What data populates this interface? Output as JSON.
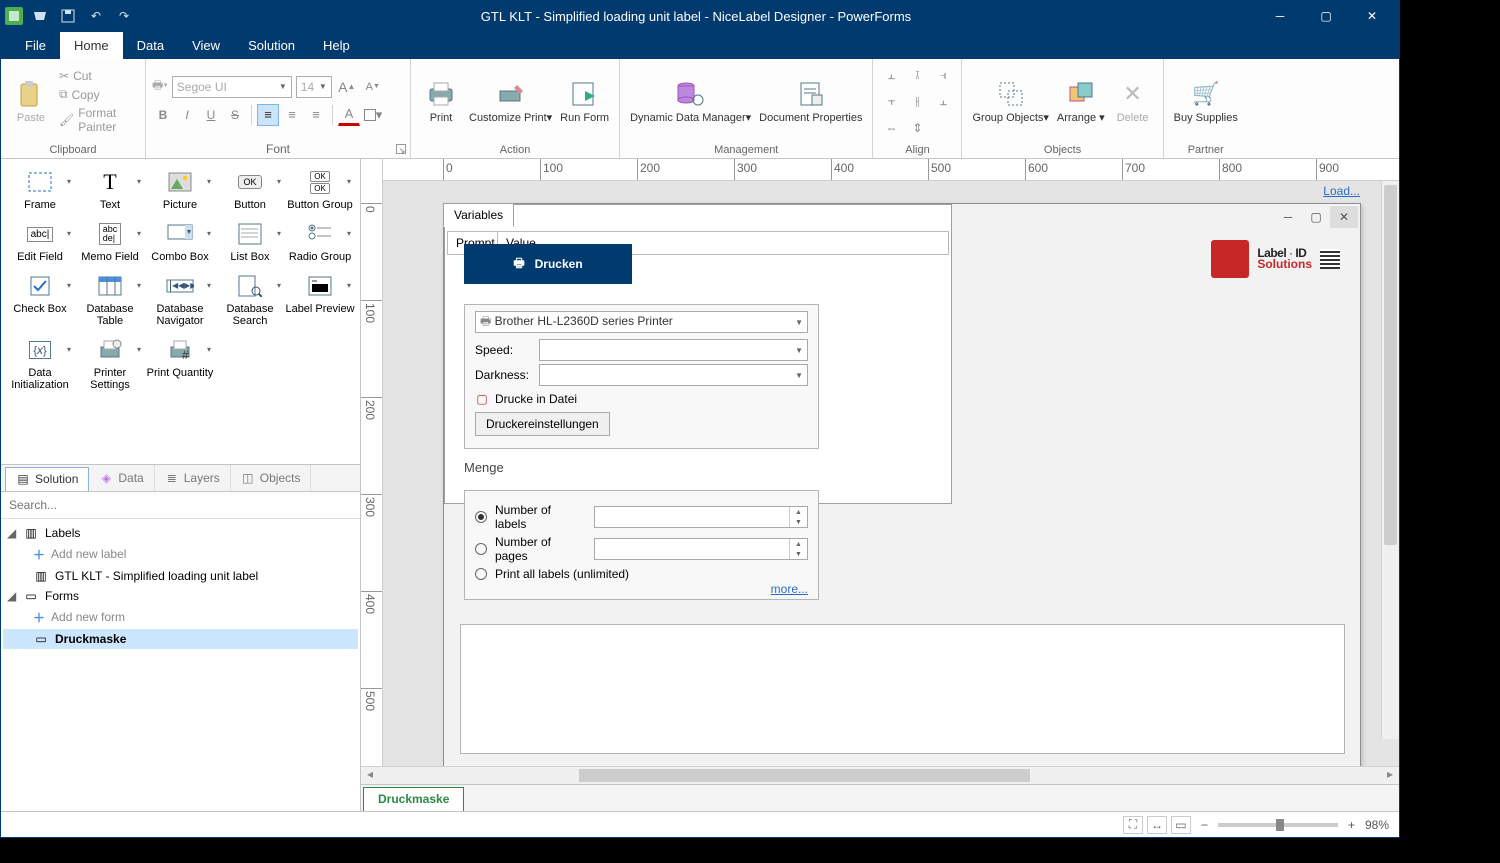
{
  "title": "GTL KLT - Simplified loading unit label - NiceLabel Designer - PowerForms",
  "menu": {
    "file": "File",
    "home": "Home",
    "data": "Data",
    "view": "View",
    "solution": "Solution",
    "help": "Help"
  },
  "ribbon": {
    "clipboard": {
      "label": "Clipboard",
      "paste": "Paste",
      "cut": "Cut",
      "copy": "Copy",
      "fmt": "Format Painter"
    },
    "font": {
      "label": "Font",
      "name": "Segoe UI",
      "size": "14"
    },
    "action": {
      "label": "Action",
      "print": "Print",
      "customize": "Customize Print▾",
      "run": "Run Form"
    },
    "management": {
      "label": "Management",
      "ddata": "Dynamic Data Manager▾",
      "docprop": "Document Properties"
    },
    "align": {
      "label": "Align"
    },
    "objects": {
      "label": "Objects",
      "group": "Group Objects▾",
      "arrange": "Arrange ▾",
      "delete": "Delete"
    },
    "partner": {
      "label": "Partner",
      "buy": "Buy Supplies"
    }
  },
  "toolbox": [
    {
      "k": "frame",
      "l": "Frame"
    },
    {
      "k": "text",
      "l": "Text"
    },
    {
      "k": "picture",
      "l": "Picture"
    },
    {
      "k": "button",
      "l": "Button"
    },
    {
      "k": "btngroup",
      "l": "Button Group"
    },
    {
      "k": "edit",
      "l": "Edit Field"
    },
    {
      "k": "memo",
      "l": "Memo Field"
    },
    {
      "k": "combo",
      "l": "Combo Box"
    },
    {
      "k": "list",
      "l": "List Box"
    },
    {
      "k": "radiog",
      "l": "Radio Group"
    },
    {
      "k": "check",
      "l": "Check Box"
    },
    {
      "k": "dbtable",
      "l": "Database Table"
    },
    {
      "k": "dbnav",
      "l": "Database Navigator"
    },
    {
      "k": "dbsearch",
      "l": "Database Search"
    },
    {
      "k": "lblprev",
      "l": "Label Preview"
    },
    {
      "k": "datainit",
      "l": "Data Initialization"
    },
    {
      "k": "prset",
      "l": "Printer Settings"
    },
    {
      "k": "prqty",
      "l": "Print Quantity"
    }
  ],
  "panels": {
    "solution": "Solution",
    "data": "Data",
    "layers": "Layers",
    "objects": "Objects",
    "search": "Search..."
  },
  "tree": {
    "labels": "Labels",
    "addlabel": "Add new label",
    "label1": "GTL KLT - Simplified loading unit label",
    "forms": "Forms",
    "addform": "Add new form",
    "form1": "Druckmaske"
  },
  "form": {
    "drucken": "Drucken",
    "logo1": "Label · ID",
    "logo2": "Solutions",
    "printer": "Brother HL-L2360D series Printer",
    "speed": "Speed:",
    "darkness": "Darkness:",
    "printfile_cb": "Drucke in Datei",
    "prsettings": "Druckereinstellungen",
    "menge": "Menge",
    "nlabels": "Number of labels",
    "npages": "Number of pages",
    "printall": "Print all labels (unlimited)",
    "more": "more...",
    "variables": "Variables",
    "load": "Load...",
    "prompt": "Prompt",
    "value": "Value"
  },
  "doctab": "Druckmaske",
  "ruler_h": [
    "0",
    "100",
    "200",
    "300",
    "400",
    "500",
    "600",
    "700",
    "800",
    "900"
  ],
  "ruler_v": [
    "0",
    "100",
    "200",
    "300",
    "400",
    "500"
  ],
  "zoom": "98%"
}
